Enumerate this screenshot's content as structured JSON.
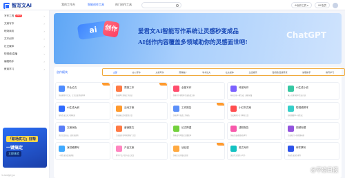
{
  "app": {
    "name": "智写文AI",
    "subtitle": "AI WRITING ASSISTANT"
  },
  "header": {
    "tabs": [
      {
        "label": "我的工作台",
        "active": false
      },
      {
        "label": "智能创作工具",
        "active": true
      },
      {
        "label": "热门创作工具",
        "active": false
      }
    ],
    "search_placeholder": "搜索",
    "btn_pill1": "AI创作工具 ▾",
    "btn_pill2": "VIP会员"
  },
  "sidebar": {
    "items": [
      {
        "label": "写作工具",
        "badge": "HOT"
      },
      {
        "label": "文案写作",
        "badge": ""
      },
      {
        "label": "职场商务",
        "badge": ""
      },
      {
        "label": "文本创作",
        "badge": ""
      },
      {
        "label": "社交媒体",
        "badge": ""
      },
      {
        "label": "短视频/直播",
        "badge": ""
      },
      {
        "label": "编程助手",
        "badge": ""
      },
      {
        "label": "教育学习",
        "badge": ""
      }
    ],
    "banner": {
      "line1": "「职场实习」好帮",
      "line2": "一键搞定",
      "line3": "立即体验"
    },
    "footer": "© 2024 智写文AI"
  },
  "hero": {
    "badge_ai": "ai",
    "badge_chuang": "创作",
    "line1": "爱君文Ai智能写作系统让灵感秒变成品",
    "line2": "AI创作内容覆盖多领域助你的灵感面世吧!",
    "decor_text": "ChatGPT"
  },
  "section": {
    "title": "创作模块",
    "filters": [
      {
        "label": "全部",
        "active": true
      },
      {
        "label": "办公写作",
        "active": false
      },
      {
        "label": "文案写作",
        "active": false
      },
      {
        "label": "营销推广",
        "active": false
      },
      {
        "label": "学术论文",
        "active": false
      },
      {
        "label": "社交媒体",
        "active": false
      },
      {
        "label": "生活娱乐",
        "active": false
      },
      {
        "label": "短视频/直播带货",
        "active": false
      },
      {
        "label": "编程助手",
        "active": false
      },
      {
        "label": "教育学习",
        "active": false
      }
    ]
  },
  "cards": [
    {
      "title": "毕业论文",
      "desc": "快速帮助写论文，让论文变得更简单",
      "icon_color": "#4e8cff",
      "tag": true
    },
    {
      "title": "周报工作",
      "desc": "快速撰写周报工作总结",
      "icon_color": "#ff7a45",
      "tag": true
    },
    {
      "title": "全能写作",
      "desc": "智能写作帮助你完成各类文章",
      "icon_color": "#ff4d6d",
      "tag": false
    },
    {
      "title": "科普写作",
      "desc": "科普文章一键生成，通俗易懂",
      "icon_color": "#7b61ff",
      "tag": false
    },
    {
      "title": "AI生成小说",
      "desc": "输入关键词即可生成小说",
      "icon_color": "#36c7a3",
      "tag": false
    },
    {
      "title": "AI生成大纲",
      "desc": "智能生成文章大纲框架",
      "icon_color": "#2f6bff",
      "tag": false
    },
    {
      "title": "活动方案",
      "desc": "轻松输出活动策划方案",
      "icon_color": "#ff9a2e",
      "tag": false
    },
    {
      "title": "工作报告",
      "desc": "快速撰写各类工作报告",
      "icon_color": "#5b8ff9",
      "tag": true
    },
    {
      "title": "小红书文案",
      "desc": "生成爆款小红书种草文案",
      "icon_color": "#ff4d4f",
      "tag": false
    },
    {
      "title": "短视频脚本",
      "desc": "短视频脚本一键生成",
      "icon_color": "#36cfc9",
      "tag": false
    },
    {
      "title": "文案润色",
      "desc": "优化文案表达，使其更流畅",
      "icon_color": "#597ef7",
      "tag": false
    },
    {
      "title": "营销推文",
      "desc": "生成高转化率营销推广文案",
      "icon_color": "#ff7a45",
      "tag": false
    },
    {
      "title": "论文降重",
      "desc": "智能改写降低论文重复率",
      "icon_color": "#73d13d",
      "tag": false
    },
    {
      "title": "述职报告",
      "desc": "快速完成述职报告撰写",
      "icon_color": "#f759ab",
      "tag": false
    },
    {
      "title": "视频标题",
      "desc": "生成吸引人的视频标题",
      "icon_color": "#9254de",
      "tag": false
    },
    {
      "title": "演讲稿撰写",
      "desc": "一键生成各类演讲稿",
      "icon_color": "#40a9ff",
      "tag": false
    },
    {
      "title": "产品文案",
      "desc": "撰写产品介绍与卖点文案",
      "icon_color": "#ff85c0",
      "tag": false
    },
    {
      "title": "读后感",
      "desc": "快速生成书籍读后感",
      "icon_color": "#ffa940",
      "tag": true
    },
    {
      "title": "英文写作",
      "desc": "英语作文润色与写作",
      "icon_color": "#13c2c2",
      "tag": false
    },
    {
      "title": "邮件撰写",
      "desc": "快速生成商务邮件",
      "icon_color": "#2f54eb",
      "tag": false
    }
  ],
  "watermark": "@平凉日报"
}
